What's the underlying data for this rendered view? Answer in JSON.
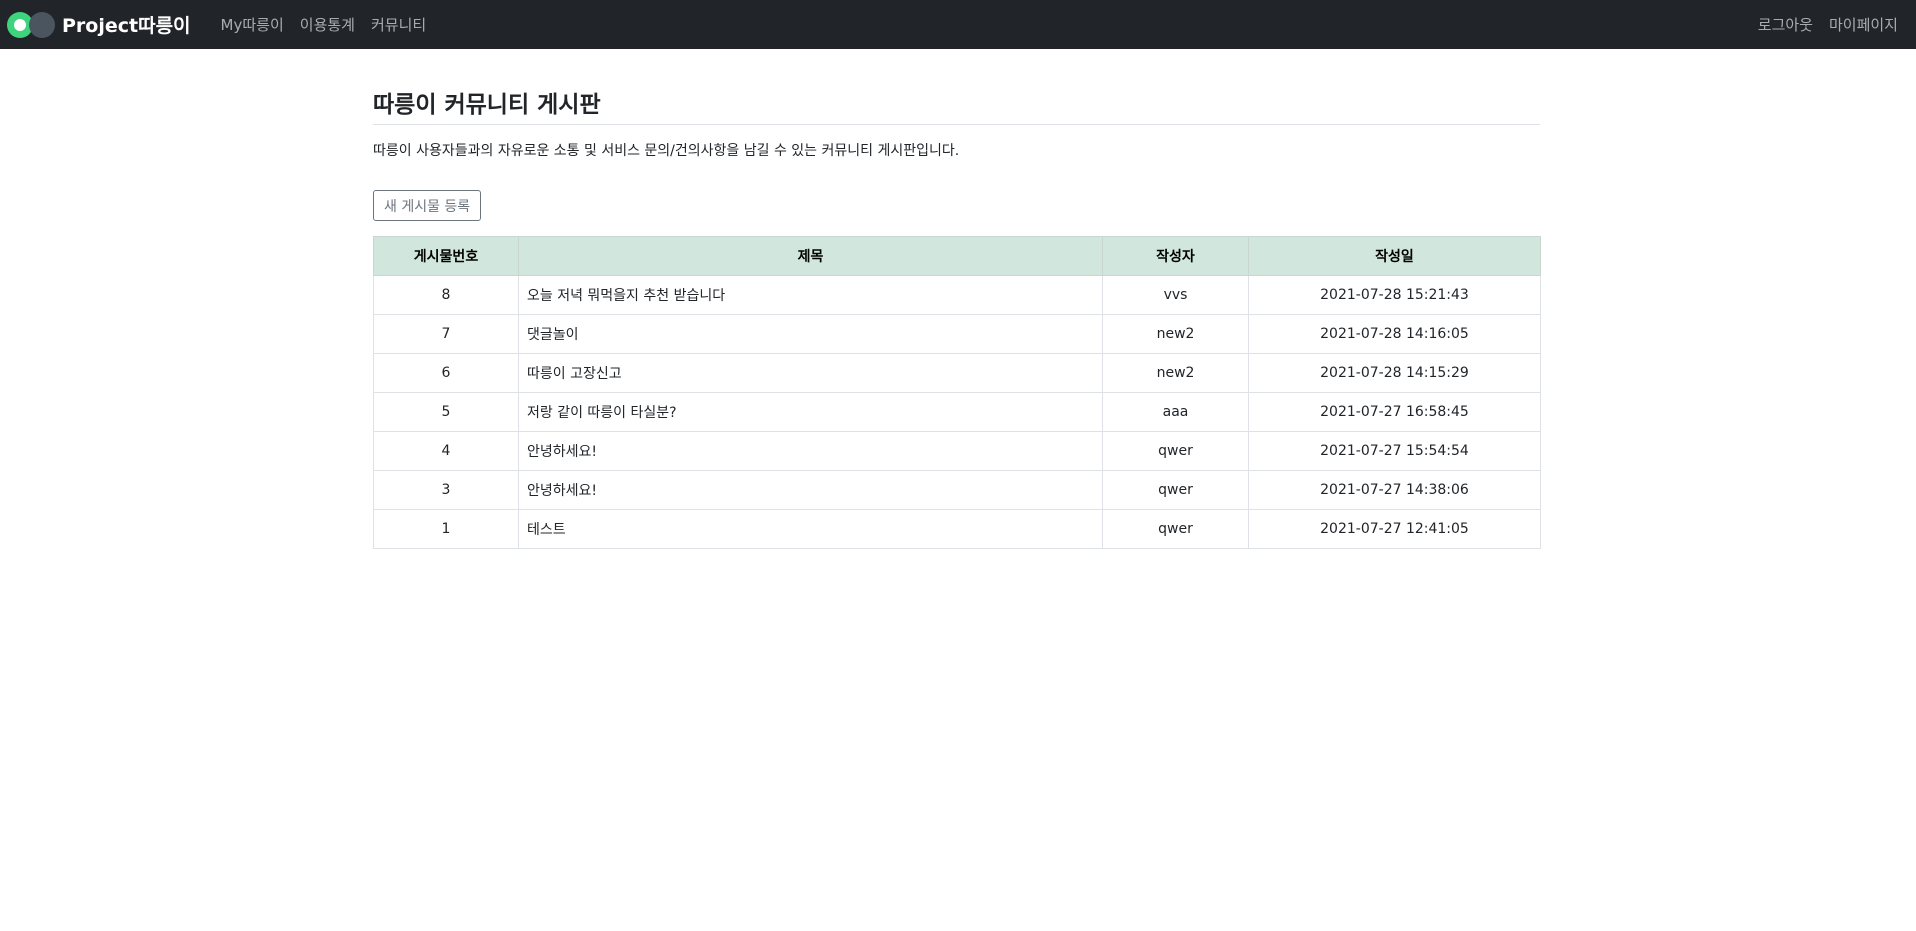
{
  "navbar": {
    "brand": "Project따릉이",
    "links_left": [
      "My따릉이",
      "이용통계",
      "커뮤니티"
    ],
    "links_right": [
      "로그아웃",
      "마이페이지"
    ],
    "bg_color": "#212529",
    "logo_colors": [
      "#3ed47d",
      "#4a5560"
    ]
  },
  "page": {
    "title": "따릉이 커뮤니티 게시판",
    "description": "따릉이 사용자들과의 자유로운 소통 및 서비스 문의/건의사항을 남길 수 있는 커뮤니티 게시판입니다.",
    "new_post_label": "새 게시물 등록"
  },
  "table": {
    "headers": [
      "게시물번호",
      "제목",
      "작성자",
      "작성일"
    ],
    "header_bg": "#d1e7dd",
    "rows": [
      {
        "no": "8",
        "title": "오늘 저녁 뭐먹을지 추천 받습니다",
        "author": "vvs",
        "date": "2021-07-28 15:21:43"
      },
      {
        "no": "7",
        "title": "댓글놀이",
        "author": "new2",
        "date": "2021-07-28 14:16:05"
      },
      {
        "no": "6",
        "title": "따릉이 고장신고",
        "author": "new2",
        "date": "2021-07-28 14:15:29"
      },
      {
        "no": "5",
        "title": "저랑 같이 따릉이 타실분?",
        "author": "aaa",
        "date": "2021-07-27 16:58:45"
      },
      {
        "no": "4",
        "title": "안녕하세요!",
        "author": "qwer",
        "date": "2021-07-27 15:54:54"
      },
      {
        "no": "3",
        "title": "안녕하세요!",
        "author": "qwer",
        "date": "2021-07-27 14:38:06"
      },
      {
        "no": "1",
        "title": "테스트",
        "author": "qwer",
        "date": "2021-07-27 12:41:05"
      }
    ]
  }
}
